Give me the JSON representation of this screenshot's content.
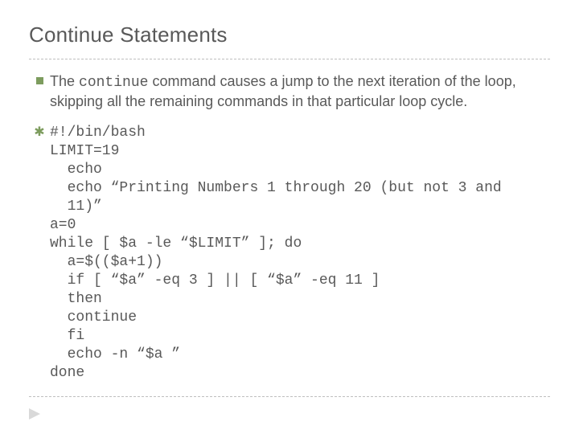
{
  "title": "Continue Statements",
  "para": {
    "pre": "The ",
    "code": "continue",
    "post": " command causes a jump to the next iteration of the loop, skipping all the remaining commands in that particular loop cycle."
  },
  "code": {
    "l0": "#!/bin/bash",
    "l1": "LIMIT=19",
    "l2": "  echo",
    "l3": "  echo “Printing Numbers 1 through 20 (but not 3 and",
    "l4": "  11)”",
    "l5": "a=0",
    "l6": "while [ $a -le “$LIMIT” ]; do",
    "l7": "  a=$(($a+1))",
    "l8": "  if [ “$a” -eq 3 ] || [ “$a” -eq 11 ]",
    "l9": "  then",
    "l10": "  continue",
    "l11": "  fi",
    "l12": "  echo -n “$a ”",
    "l13": "done"
  }
}
